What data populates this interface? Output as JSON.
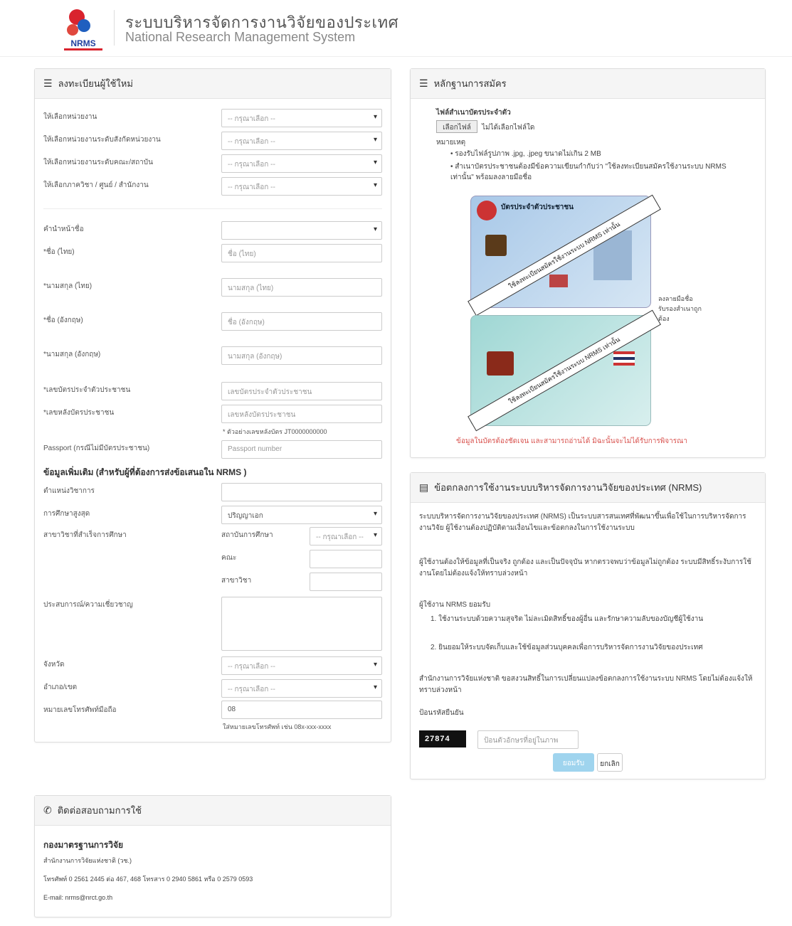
{
  "header": {
    "title_th": "ระบบบริหารจัดการงานวิจัยของประเทศ",
    "title_en": "National Research Management System",
    "logo_text": "NRMS"
  },
  "register": {
    "title": "ลงทะเบียนผู้ใช้ใหม่",
    "fields": [
      {
        "label": "ให้เลือกหน่วยงาน",
        "value": "-- กรุณาเลือก --"
      },
      {
        "label": "ให้เลือกหน่วยงานระดับสังกัดหน่วยงาน",
        "value": "-- กรุณาเลือก --"
      },
      {
        "label": "ให้เลือกหน่วยงานระดับคณะ/สถาบัน",
        "value": "-- กรุณาเลือก --"
      },
      {
        "label": "ให้เลือกภาควิชา / ศูนย์ / สำนักงาน",
        "value": "-- กรุณาเลือก --"
      }
    ],
    "title_prefix_label": "คำนำหน้าชื่อ",
    "name_th_label": "*ชื่อ (ไทย)",
    "name_th_placeholder": "ชื่อ (ไทย)",
    "surname_th_label": "*นามสกุล (ไทย)",
    "surname_th_placeholder": "นามสกุล (ไทย)",
    "name_en_label": "*ชื่อ (อังกฤษ)",
    "name_en_placeholder": "ชื่อ (อังกฤษ)",
    "surname_en_label": "*นามสกุล (อังกฤษ)",
    "surname_en_placeholder": "นามสกุล (อังกฤษ)",
    "id_label": "*เลขบัตรประจำตัวประชาชน",
    "id_placeholder": "เลขบัตรประจำตัวประชาชน",
    "laser_label": "*เลขหลังบัตรประชาชน",
    "laser_placeholder": "เลขหลังบัตรประชาชน",
    "laser_help": "* ตัวอย่างเลขหลังบัตร JT0000000000",
    "passport_label": "Passport (กรณีไม่มีบัตรประชาชน)",
    "passport_placeholder": "Passport number",
    "extra_section": "ข้อมูลเพิ่มเติม (สำหรับผู้ที่ต้องการส่งข้อเสนอใน NRMS )",
    "position_label": "ตำแหน่งวิชาการ",
    "education_label": "การศึกษาสูงสุด",
    "education_value": "ปริญญาเอก",
    "degree_label": "สาขาวิชาที่สำเร็จการศึกษา",
    "degree_sub1": "สถาบันการศึกษา",
    "degree_sub1_value": "-- กรุณาเลือก --",
    "degree_sub2": "คณะ",
    "degree_sub3": "สาขาวิชา",
    "expertise_label": "ประสบการณ์/ความเชี่ยวชาญ",
    "province_label": "จังหวัด",
    "province_value": "-- กรุณาเลือก --",
    "district_label": "อำเภอ/เขต",
    "district_value": "-- กรุณาเลือก --",
    "phone_label": "หมายเลขโทรศัพท์มือถือ",
    "phone_value": "08",
    "phone_help": "ใส่หมายเลขโทรศัพท์ เช่น 08x-xxx-xxxx"
  },
  "evidence": {
    "title": "หลักฐานการสมัคร",
    "upload_label": "ไฟล์สำเนาบัตรประจำตัว",
    "choose_button": "เลือกไฟล์",
    "no_file": "ไม่ได้เลือกไฟล์ใด",
    "note_head": "หมายเหตุ",
    "note1": "รองรับไฟล์รูปภาพ .jpg, .jpeg ขนาดไม่เกิน 2 MB",
    "note2": "สำเนาบัตรประชาชนต้องมีข้อความเขียนกำกับว่า \"ใช้ลงทะเบียนสมัครใช้งานระบบ NRMS เท่านั้น\" พร้อมลงลายมือชื่อ",
    "card_header": "บัตรประจำตัวประชาชน",
    "stamp_text": "ใช้ลงทะเบียนสมัครใช้งานระบบ NRMS เท่านั้น",
    "side_note": "ลงลายมือชื่อ รับรองสำเนาถูกต้อง",
    "red_note": "ข้อมูลในบัตรต้องชัดเจน และสามารถอ่านได้ มิฉะนั้นจะไม่ได้รับการพิจารณา"
  },
  "terms": {
    "title": "ข้อตกลงการใช้งานระบบบริหารจัดการงานวิจัยของประเทศ (NRMS)",
    "para1": "ระบบบริหารจัดการงานวิจัยของประเทศ (NRMS) เป็นระบบสารสนเทศที่พัฒนาขึ้นเพื่อใช้ในการบริหารจัดการงานวิจัย ผู้ใช้งานต้องปฏิบัติตามเงื่อนไขและข้อตกลงในการใช้งานระบบ",
    "para2": "ผู้ใช้งานต้องให้ข้อมูลที่เป็นจริง ถูกต้อง และเป็นปัจจุบัน หากตรวจพบว่าข้อมูลไม่ถูกต้อง ระบบมีสิทธิ์ระงับการใช้งานโดยไม่ต้องแจ้งให้ทราบล่วงหน้า",
    "sub_head": "ผู้ใช้งาน NRMS ยอมรับ",
    "item1": "ใช้งานระบบด้วยความสุจริต ไม่ละเมิดสิทธิ์ของผู้อื่น และรักษาความลับของบัญชีผู้ใช้งาน",
    "item2": "ยินยอมให้ระบบจัดเก็บและใช้ข้อมูลส่วนบุคคลเพื่อการบริหารจัดการงานวิจัยของประเทศ",
    "para3": "สำนักงานการวิจัยแห่งชาติ ขอสงวนสิทธิ์ในการเปลี่ยนแปลงข้อตกลงการใช้งานระบบ NRMS โดยไม่ต้องแจ้งให้ทราบล่วงหน้า",
    "captcha_label": "ป้อนรหัสยืนยัน",
    "captcha_code": "27874",
    "captcha_placeholder": "ป้อนตัวอักษรที่อยู่ในภาพ",
    "accept_button": "ยอมรับ",
    "cancel_button": "ยกเลิก"
  },
  "contact": {
    "title": "ติดต่อสอบถามการใช้",
    "org": "กองมาตรฐานการวิจัย",
    "org_sub": "สำนักงานการวิจัยแห่งชาติ (วช.)",
    "phone": "โทรศัพท์ 0 2561 2445 ต่อ 467, 468 โทรสาร 0 2940 5861 หรือ 0 2579 0593",
    "email": "E-mail: nrms@nrct.go.th"
  }
}
